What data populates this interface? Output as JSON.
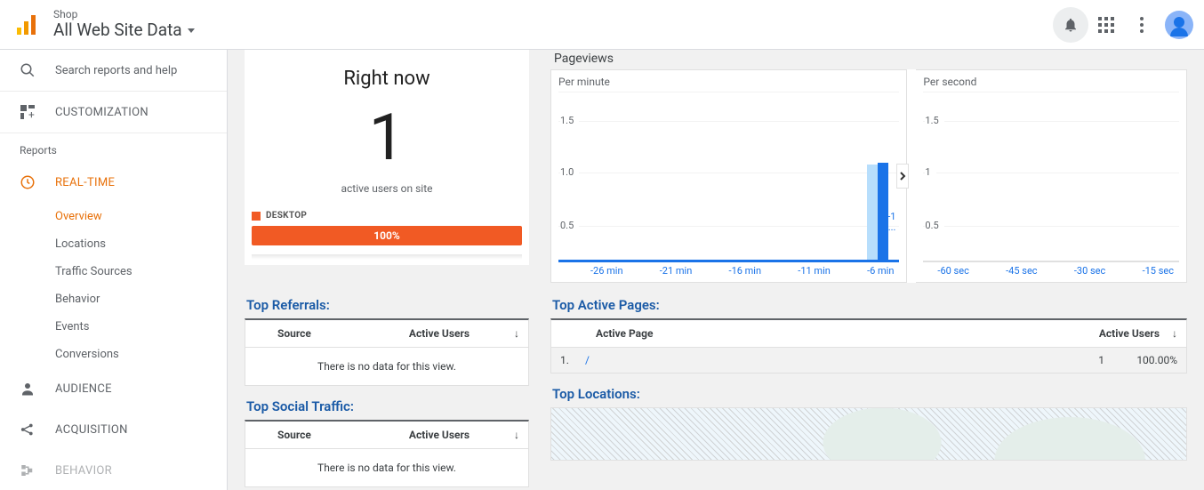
{
  "header": {
    "account": "Shop",
    "view": "All Web Site Data"
  },
  "search": {
    "placeholder": "Search reports and help"
  },
  "nav": {
    "customization": "CUSTOMIZATION",
    "reports_label": "Reports",
    "realtime": "REAL-TIME",
    "audience": "AUDIENCE",
    "acquisition": "ACQUISITION",
    "behavior": "BEHAVIOR",
    "sub": {
      "overview": "Overview",
      "locations": "Locations",
      "traffic_sources": "Traffic Sources",
      "behavior": "Behavior",
      "events": "Events",
      "conversions": "Conversions"
    }
  },
  "right_now": {
    "title": "Right now",
    "value": "1",
    "sub": "active users on site",
    "device_label": "DESKTOP",
    "bar_pct": "100%"
  },
  "pageviews": {
    "title": "Pageviews",
    "per_minute": "Per minute",
    "per_second": "Per second",
    "y": {
      "a": "1.5",
      "b": "1.0",
      "c": "0.5"
    },
    "y2": {
      "a": "1.5",
      "b": "1",
      "c": "0.5"
    },
    "x_min": [
      "-26 min",
      "-21 min",
      "-16 min",
      "-11 min",
      "-6 min"
    ],
    "neg1": "-1\n...",
    "x_sec": [
      "-60 sec",
      "-45 sec",
      "-30 sec",
      "-15 sec"
    ]
  },
  "sections": {
    "top_referrals": "Top Referrals:",
    "top_social": "Top Social Traffic:",
    "top_active": "Top Active Pages:",
    "top_locations": "Top Locations:"
  },
  "table_labels": {
    "source": "Source",
    "active_users": "Active Users",
    "active_page": "Active Page",
    "no_data": "There is no data for this view."
  },
  "active_pages": {
    "row1": {
      "idx": "1.",
      "page": "/",
      "users": "1",
      "pct": "100.00%"
    }
  },
  "chart_data": {
    "type": "bar",
    "per_minute": {
      "x_unit": "min",
      "x_range": [
        -30,
        0
      ],
      "y_range": [
        0,
        1.5
      ],
      "note": "single bar ≈1.0 near -1 min; rest ≈0"
    },
    "per_second": {
      "x_unit": "sec",
      "x_range": [
        -60,
        0
      ],
      "y_range": [
        0,
        1.5
      ],
      "note": "no visible bars"
    }
  }
}
